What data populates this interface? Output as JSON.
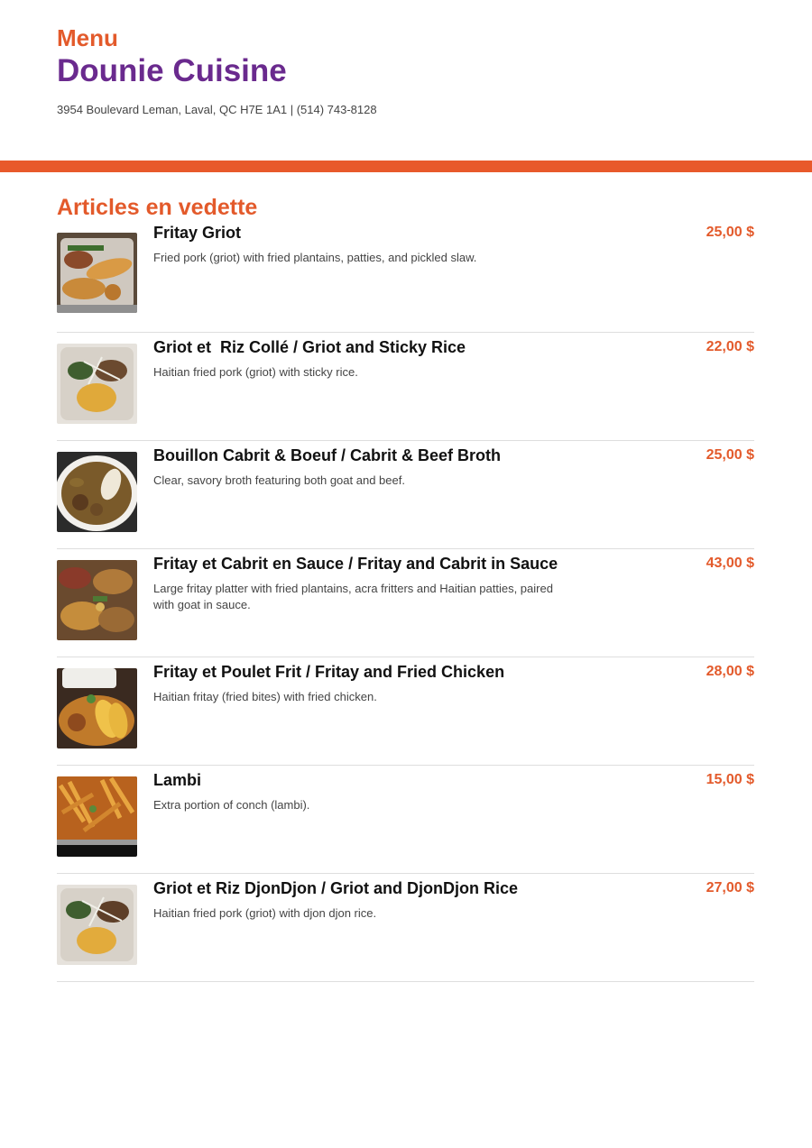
{
  "header": {
    "menu_label": "Menu",
    "restaurant_name": "Dounie Cuisine",
    "address_line": "3954 Boulevard Leman, Laval, QC H7E 1A1 | (514) 743-8128"
  },
  "colors": {
    "accent": "#e8592b",
    "title_purple": "#6a2a8e"
  },
  "section": {
    "title": "Articles en vedette",
    "items": [
      {
        "name": "Fritay Griot",
        "description": "Fried pork (griot) with fried plantains, patties, and pickled slaw.",
        "price": "25,00 $"
      },
      {
        "name": "Griot et  Riz Collé / Griot and Sticky Rice",
        "description": "Haitian fried pork (griot) with sticky rice.",
        "price": "22,00 $"
      },
      {
        "name": "Bouillon Cabrit & Boeuf / Cabrit & Beef Broth",
        "description": "Clear, savory broth featuring both goat and beef.",
        "price": "25,00 $"
      },
      {
        "name": "Fritay et Cabrit en Sauce / Fritay and Cabrit in Sauce",
        "description": "Large fritay platter with fried plantains, acra fritters and Haitian patties, paired with goat in sauce.",
        "price": "43,00 $"
      },
      {
        "name": "Fritay et Poulet Frit / Fritay and Fried Chicken",
        "description": "Haitian fritay (fried bites) with fried chicken.",
        "price": "28,00 $"
      },
      {
        "name": "Lambi",
        "description": "Extra portion of conch (lambi).",
        "price": "15,00 $"
      },
      {
        "name": "Griot et Riz DjonDjon / Griot and DjonDjon Rice",
        "description": "Haitian fried pork (griot) with djon djon rice.",
        "price": "27,00 $"
      }
    ]
  }
}
